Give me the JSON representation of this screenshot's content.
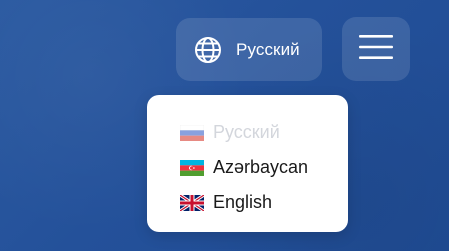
{
  "header": {
    "language_button": {
      "icon": "globe-icon",
      "label": "Русский"
    },
    "menu_button": {
      "icon": "hamburger-menu-icon"
    }
  },
  "language_dropdown": {
    "items": [
      {
        "label": "Русский",
        "flag": "russia-flag-icon",
        "active": true
      },
      {
        "label": "Azərbaycan",
        "flag": "azerbaijan-flag-icon",
        "active": false
      },
      {
        "label": "English",
        "flag": "uk-flag-icon",
        "active": false
      }
    ]
  },
  "colors": {
    "background": "#24519a",
    "active_item_text": "#d3d6dc",
    "item_text": "#1a1a1a"
  }
}
